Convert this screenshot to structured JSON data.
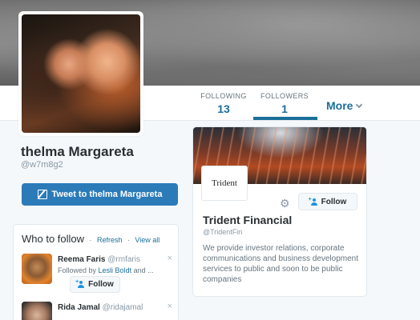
{
  "profile": {
    "name": "thelma Margareta",
    "handle": "@w7m8g2",
    "tweet_button_label": "Tweet to thelma Margareta"
  },
  "nav": {
    "following_label": "FOLLOWING",
    "following_count": "13",
    "followers_label": "FOLLOWERS",
    "followers_count": "1",
    "more_label": "More"
  },
  "who_to_follow": {
    "title": "Who to follow",
    "separator": "·",
    "refresh_label": "Refresh",
    "view_all_label": "View all",
    "suggestions": [
      {
        "name": "Reema Faris",
        "handle": "@rmfaris",
        "followed_by_prefix": "Followed by",
        "followed_by_link": "Lesli Boldt",
        "followed_by_suffix": "and ...",
        "follow_label": "Follow",
        "close": "×"
      },
      {
        "name": "Rida Jamal",
        "handle": "@ridajamal",
        "close": "×"
      }
    ]
  },
  "follower_card": {
    "logo_text": "Trident",
    "name": "Trident Financial",
    "handle": "@TridentFin",
    "follow_label": "Follow",
    "bio": "We provide investor relations, corporate communications and business development services to public and soon to be public companies"
  },
  "colors": {
    "accent": "#1b6f99",
    "tweet_button": "#2b7bb9",
    "page_background": "#f5f8fa"
  },
  "icons": {
    "tweet_button": "compose-icon",
    "more": "chevron-down-icon",
    "follow": "person-plus-icon",
    "settings": "gear-icon",
    "dismiss": "close-icon"
  }
}
